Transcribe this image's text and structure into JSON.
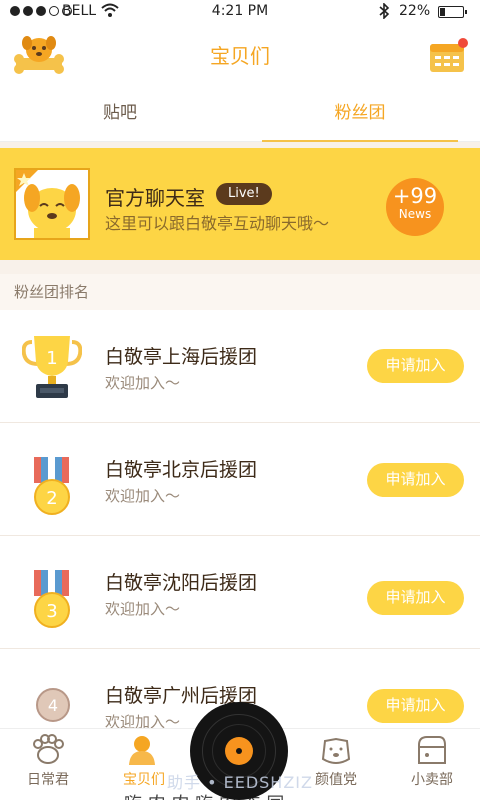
{
  "status_bar": {
    "carrier": "BELL",
    "time": "4:21 PM",
    "battery": "22%"
  },
  "header": {
    "title": "宝贝们"
  },
  "tabs": [
    {
      "label": "贴吧",
      "active": false
    },
    {
      "label": "粉丝团",
      "active": true
    }
  ],
  "chat_room": {
    "name": "官方聊天室",
    "badge": "Live!",
    "description": "这里可以跟白敬亭互动聊天哦～",
    "news_count": "+99",
    "news_label": "News"
  },
  "ranking": {
    "section_title": "粉丝团排名",
    "items": [
      {
        "rank": "1",
        "name": "白敬亭上海后援团",
        "subtitle": "欢迎加入～",
        "button": "申请加入"
      },
      {
        "rank": "2",
        "name": "白敬亭北京后援团",
        "subtitle": "欢迎加入～",
        "button": "申请加入"
      },
      {
        "rank": "3",
        "name": "白敬亭沈阳后援团",
        "subtitle": "欢迎加入～",
        "button": "申请加入"
      },
      {
        "rank": "4",
        "name": "白敬亭广州后援团",
        "subtitle": "欢迎加入～",
        "button": "申请加入"
      }
    ]
  },
  "bottom_nav": [
    {
      "label": "日常君",
      "icon": "paw-icon"
    },
    {
      "label": "宝贝们",
      "icon": "fans-icon",
      "active": true
    },
    {
      "label": "颜值党",
      "icon": "dog-face-icon"
    },
    {
      "label": "小卖部",
      "icon": "shop-icon"
    }
  ],
  "watermark": "助手 • EEDSHZIZ",
  "partial_text": "嗨 肉 肉 嗨 肉 奋 同",
  "colors": {
    "accent": "#f5a623",
    "banner": "#fdd545",
    "news": "#f7931e"
  }
}
